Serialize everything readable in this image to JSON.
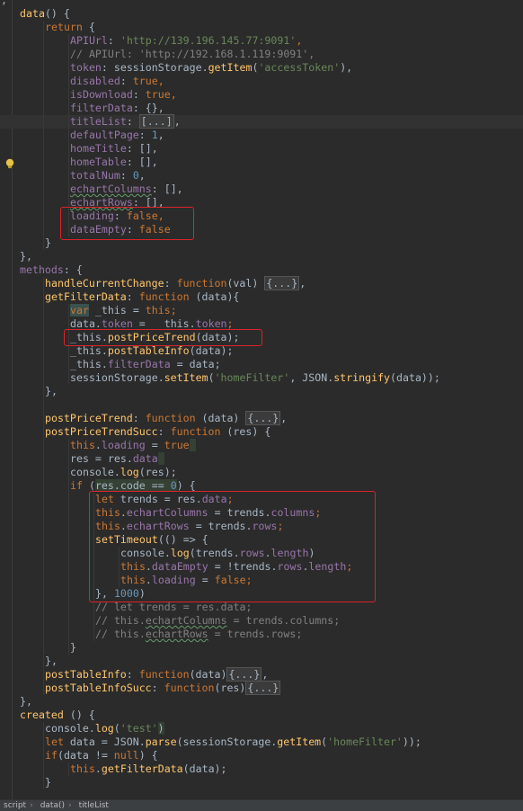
{
  "editor": {
    "lines": [
      {
        "indent": 0,
        "tokens": [
          {
            "t": "},",
            "c": "txt"
          }
        ]
      },
      {
        "indent": 1,
        "tokens": [
          {
            "t": "data",
            "c": "fn"
          },
          {
            "t": "() {",
            "c": "txt"
          }
        ]
      },
      {
        "indent": 2,
        "tokens": [
          {
            "t": "return",
            "c": "kw"
          },
          {
            "t": " {",
            "c": "txt"
          }
        ]
      },
      {
        "indent": 3,
        "tokens": [
          {
            "t": "APIUrl",
            "c": "prop"
          },
          {
            "t": ": ",
            "c": "txt"
          },
          {
            "t": "'http://139.196.145.77:9091'",
            "c": "str"
          },
          {
            "t": ",",
            "c": "kw"
          }
        ]
      },
      {
        "indent": 3,
        "tokens": [
          {
            "t": "// APIUrl: 'http://192.168.1.119:9091',",
            "c": "cmt"
          }
        ]
      },
      {
        "indent": 3,
        "tokens": [
          {
            "t": "token",
            "c": "prop"
          },
          {
            "t": ": sessionStorage.",
            "c": "txt"
          },
          {
            "t": "getItem",
            "c": "fn"
          },
          {
            "t": "(",
            "c": "txt"
          },
          {
            "t": "'accessToken'",
            "c": "str"
          },
          {
            "t": "),",
            "c": "txt"
          }
        ]
      },
      {
        "indent": 3,
        "tokens": [
          {
            "t": "disabled",
            "c": "prop"
          },
          {
            "t": ": ",
            "c": "txt"
          },
          {
            "t": "true",
            "c": "kw"
          },
          {
            "t": ",",
            "c": "kw"
          }
        ]
      },
      {
        "indent": 3,
        "tokens": [
          {
            "t": "isDownload",
            "c": "prop"
          },
          {
            "t": ": ",
            "c": "txt"
          },
          {
            "t": "true",
            "c": "kw"
          },
          {
            "t": ",",
            "c": "kw"
          }
        ]
      },
      {
        "indent": 3,
        "tokens": [
          {
            "t": "filterData",
            "c": "prop"
          },
          {
            "t": ": {},",
            "c": "txt"
          }
        ]
      },
      {
        "indent": 3,
        "caret": true,
        "tokens": [
          {
            "t": "titleList",
            "c": "prop"
          },
          {
            "t": ": ",
            "c": "txt"
          },
          {
            "t": "[...]",
            "c": "fold"
          },
          {
            "t": ",",
            "c": "txt"
          }
        ]
      },
      {
        "indent": 3,
        "tokens": [
          {
            "t": "defaultPage",
            "c": "prop"
          },
          {
            "t": ": ",
            "c": "txt"
          },
          {
            "t": "1",
            "c": "num"
          },
          {
            "t": ",",
            "c": "txt"
          }
        ]
      },
      {
        "indent": 3,
        "tokens": [
          {
            "t": "homeTitle",
            "c": "prop"
          },
          {
            "t": ": [],",
            "c": "txt"
          }
        ]
      },
      {
        "indent": 3,
        "tokens": [
          {
            "t": "homeTable",
            "c": "prop"
          },
          {
            "t": ": [],",
            "c": "txt"
          }
        ]
      },
      {
        "indent": 3,
        "tokens": [
          {
            "t": "totalNum",
            "c": "prop"
          },
          {
            "t": ": ",
            "c": "txt"
          },
          {
            "t": "0",
            "c": "num"
          },
          {
            "t": ",",
            "c": "txt"
          }
        ]
      },
      {
        "indent": 3,
        "tokens": [
          {
            "t": "echartColumns",
            "c": "prop squig"
          },
          {
            "t": ": [],",
            "c": "txt"
          }
        ]
      },
      {
        "indent": 3,
        "tokens": [
          {
            "t": "echartRows",
            "c": "prop squig"
          },
          {
            "t": ": [],",
            "c": "txt"
          }
        ]
      },
      {
        "indent": 3,
        "tokens": [
          {
            "t": "loading",
            "c": "prop"
          },
          {
            "t": ": ",
            "c": "txt"
          },
          {
            "t": "false",
            "c": "kw"
          },
          {
            "t": ",",
            "c": "kw"
          }
        ]
      },
      {
        "indent": 3,
        "tokens": [
          {
            "t": "dataEmpty",
            "c": "prop"
          },
          {
            "t": ": ",
            "c": "txt"
          },
          {
            "t": "false",
            "c": "kw"
          }
        ]
      },
      {
        "indent": 2,
        "tokens": [
          {
            "t": "}",
            "c": "txt"
          }
        ]
      },
      {
        "indent": 1,
        "tokens": [
          {
            "t": "},",
            "c": "txt"
          }
        ]
      },
      {
        "indent": 1,
        "tokens": [
          {
            "t": "methods",
            "c": "prop"
          },
          {
            "t": ": {",
            "c": "txt"
          }
        ]
      },
      {
        "indent": 2,
        "tokens": [
          {
            "t": "handleCurrentChange",
            "c": "fn"
          },
          {
            "t": ": ",
            "c": "txt"
          },
          {
            "t": "function",
            "c": "kw"
          },
          {
            "t": "(val) ",
            "c": "txt"
          },
          {
            "t": "{...}",
            "c": "fold"
          },
          {
            "t": ",",
            "c": "txt"
          }
        ]
      },
      {
        "indent": 2,
        "tokens": [
          {
            "t": "getFilterData",
            "c": "fn"
          },
          {
            "t": ": ",
            "c": "txt"
          },
          {
            "t": "function",
            "c": "kw"
          },
          {
            "t": " (data){",
            "c": "txt"
          }
        ]
      },
      {
        "indent": 3,
        "tokens": [
          {
            "t": "var",
            "c": "kw hl"
          },
          {
            "t": " _this = ",
            "c": "txt"
          },
          {
            "t": "this",
            "c": "kw"
          },
          {
            "t": ";",
            "c": "kw"
          }
        ]
      },
      {
        "indent": 3,
        "tokens": [
          {
            "t": "data.",
            "c": "txt"
          },
          {
            "t": "token",
            "c": "prop"
          },
          {
            "t": " =  ",
            "c": "txt"
          },
          {
            "t": "_this.",
            "c": "txt"
          },
          {
            "t": "token",
            "c": "prop"
          },
          {
            "t": ";",
            "c": "kw"
          }
        ]
      },
      {
        "indent": 3,
        "tokens": [
          {
            "t": "_this.",
            "c": "txt"
          },
          {
            "t": "postPriceTrend",
            "c": "fn"
          },
          {
            "t": "(data);",
            "c": "txt"
          }
        ]
      },
      {
        "indent": 3,
        "tokens": [
          {
            "t": "_this.",
            "c": "txt"
          },
          {
            "t": "postTableInfo",
            "c": "fn"
          },
          {
            "t": "(data);",
            "c": "txt"
          }
        ]
      },
      {
        "indent": 3,
        "tokens": [
          {
            "t": "_this.",
            "c": "txt"
          },
          {
            "t": "filterData",
            "c": "prop"
          },
          {
            "t": " = data;",
            "c": "txt"
          }
        ]
      },
      {
        "indent": 3,
        "tokens": [
          {
            "t": "sessionStorage.",
            "c": "txt"
          },
          {
            "t": "setItem",
            "c": "fn"
          },
          {
            "t": "(",
            "c": "txt"
          },
          {
            "t": "'homeFilter'",
            "c": "str"
          },
          {
            "t": ", JSON.",
            "c": "txt"
          },
          {
            "t": "stringify",
            "c": "fn"
          },
          {
            "t": "(data));",
            "c": "txt"
          }
        ]
      },
      {
        "indent": 2,
        "tokens": [
          {
            "t": "},",
            "c": "txt"
          }
        ]
      },
      {
        "indent": 2,
        "tokens": [
          {
            "t": "",
            "c": "txt"
          }
        ]
      },
      {
        "indent": 2,
        "tokens": [
          {
            "t": "postPriceTrend",
            "c": "fn"
          },
          {
            "t": ": ",
            "c": "txt"
          },
          {
            "t": "function",
            "c": "kw"
          },
          {
            "t": " (data) ",
            "c": "txt"
          },
          {
            "t": "{...}",
            "c": "fold"
          },
          {
            "t": ",",
            "c": "txt"
          }
        ]
      },
      {
        "indent": 2,
        "tokens": [
          {
            "t": "postPriceTrendSucc",
            "c": "fn"
          },
          {
            "t": ": ",
            "c": "txt"
          },
          {
            "t": "function",
            "c": "kw"
          },
          {
            "t": " (res) {",
            "c": "txt"
          }
        ]
      },
      {
        "indent": 3,
        "tokens": [
          {
            "t": "this",
            "c": "kw"
          },
          {
            "t": ".",
            "c": "txt"
          },
          {
            "t": "loading",
            "c": "prop"
          },
          {
            "t": " = ",
            "c": "txt"
          },
          {
            "t": "true",
            "c": "kw"
          },
          {
            "t": " ",
            "c": "hl2"
          }
        ]
      },
      {
        "indent": 3,
        "tokens": [
          {
            "t": "res = res.",
            "c": "txt"
          },
          {
            "t": "data",
            "c": "prop"
          },
          {
            "t": " ",
            "c": "hl2"
          }
        ]
      },
      {
        "indent": 3,
        "tokens": [
          {
            "t": "console.",
            "c": "txt"
          },
          {
            "t": "log",
            "c": "fn"
          },
          {
            "t": "(res);",
            "c": "txt"
          }
        ]
      },
      {
        "indent": 3,
        "tokens": [
          {
            "t": "if",
            "c": "kw"
          },
          {
            "t": " (",
            "c": "txt"
          },
          {
            "t": "res.code == ",
            "c": "txt hl2"
          },
          {
            "t": "0",
            "c": "num hl2"
          },
          {
            "t": ") {",
            "c": "txt"
          }
        ]
      },
      {
        "indent": 4,
        "tokens": [
          {
            "t": "let",
            "c": "kw"
          },
          {
            "t": " trends = res.",
            "c": "txt"
          },
          {
            "t": "data",
            "c": "prop"
          },
          {
            "t": ";",
            "c": "kw"
          }
        ]
      },
      {
        "indent": 4,
        "tokens": [
          {
            "t": "this",
            "c": "kw"
          },
          {
            "t": ".",
            "c": "txt"
          },
          {
            "t": "echartColumns",
            "c": "prop"
          },
          {
            "t": " = trends.",
            "c": "txt"
          },
          {
            "t": "columns",
            "c": "prop"
          },
          {
            "t": ";",
            "c": "kw"
          }
        ]
      },
      {
        "indent": 4,
        "tokens": [
          {
            "t": "this",
            "c": "kw"
          },
          {
            "t": ".",
            "c": "txt"
          },
          {
            "t": "echartRows",
            "c": "prop"
          },
          {
            "t": " = trends.",
            "c": "txt"
          },
          {
            "t": "rows",
            "c": "prop"
          },
          {
            "t": ";",
            "c": "kw"
          }
        ]
      },
      {
        "indent": 4,
        "tokens": [
          {
            "t": "setTimeout",
            "c": "fn"
          },
          {
            "t": "(() => {",
            "c": "txt"
          }
        ]
      },
      {
        "indent": 5,
        "tokens": [
          {
            "t": "console.",
            "c": "txt"
          },
          {
            "t": "log",
            "c": "fn"
          },
          {
            "t": "(trends.",
            "c": "txt"
          },
          {
            "t": "rows",
            "c": "prop"
          },
          {
            "t": ".",
            "c": "txt"
          },
          {
            "t": "length",
            "c": "prop"
          },
          {
            "t": ")",
            "c": "txt"
          }
        ]
      },
      {
        "indent": 5,
        "tokens": [
          {
            "t": "this",
            "c": "kw"
          },
          {
            "t": ".",
            "c": "txt"
          },
          {
            "t": "dataEmpty",
            "c": "prop"
          },
          {
            "t": " = !trends.",
            "c": "txt"
          },
          {
            "t": "rows",
            "c": "prop"
          },
          {
            "t": ".",
            "c": "txt"
          },
          {
            "t": "length",
            "c": "prop"
          },
          {
            "t": ";",
            "c": "kw"
          }
        ]
      },
      {
        "indent": 5,
        "tokens": [
          {
            "t": "this",
            "c": "kw"
          },
          {
            "t": ".",
            "c": "txt"
          },
          {
            "t": "loading",
            "c": "prop"
          },
          {
            "t": " = ",
            "c": "txt"
          },
          {
            "t": "false",
            "c": "kw"
          },
          {
            "t": ";",
            "c": "kw"
          }
        ]
      },
      {
        "indent": 4,
        "tokens": [
          {
            "t": "}, ",
            "c": "txt"
          },
          {
            "t": "1000",
            "c": "num"
          },
          {
            "t": ")",
            "c": "txt"
          }
        ]
      },
      {
        "indent": 4,
        "tokens": [
          {
            "t": "// let trends = res.data;",
            "c": "cmt"
          }
        ]
      },
      {
        "indent": 4,
        "tokens": [
          {
            "t": "// this.",
            "c": "cmt"
          },
          {
            "t": "echartColumns",
            "c": "cmt squig"
          },
          {
            "t": " = trends.columns;",
            "c": "cmt"
          }
        ]
      },
      {
        "indent": 4,
        "tokens": [
          {
            "t": "// this.",
            "c": "cmt"
          },
          {
            "t": "echartRows",
            "c": "cmt squig"
          },
          {
            "t": " = trends.rows;",
            "c": "cmt"
          }
        ]
      },
      {
        "indent": 3,
        "tokens": [
          {
            "t": "}",
            "c": "txt"
          }
        ]
      },
      {
        "indent": 2,
        "tokens": [
          {
            "t": "},",
            "c": "txt"
          }
        ]
      },
      {
        "indent": 2,
        "tokens": [
          {
            "t": "postTableInfo",
            "c": "fn"
          },
          {
            "t": ": ",
            "c": "txt"
          },
          {
            "t": "function",
            "c": "kw"
          },
          {
            "t": "(data)",
            "c": "txt"
          },
          {
            "t": "{...}",
            "c": "fold"
          },
          {
            "t": ",",
            "c": "txt"
          }
        ]
      },
      {
        "indent": 2,
        "tokens": [
          {
            "t": "postTableInfoSucc",
            "c": "fn"
          },
          {
            "t": ": ",
            "c": "txt"
          },
          {
            "t": "function",
            "c": "kw"
          },
          {
            "t": "(res)",
            "c": "txt"
          },
          {
            "t": "{...}",
            "c": "fold"
          }
        ]
      },
      {
        "indent": 1,
        "tokens": [
          {
            "t": "},",
            "c": "txt"
          }
        ]
      },
      {
        "indent": 1,
        "tokens": [
          {
            "t": "created",
            "c": "fn"
          },
          {
            "t": " () {",
            "c": "txt"
          }
        ]
      },
      {
        "indent": 2,
        "tokens": [
          {
            "t": "console.",
            "c": "txt"
          },
          {
            "t": "log",
            "c": "fn"
          },
          {
            "t": "(",
            "c": "txt"
          },
          {
            "t": "'test'",
            "c": "str"
          },
          {
            "t": ")",
            "c": "txt hl2"
          }
        ]
      },
      {
        "indent": 2,
        "tokens": [
          {
            "t": "let",
            "c": "kw"
          },
          {
            "t": " data = JSON.",
            "c": "txt"
          },
          {
            "t": "parse",
            "c": "fn"
          },
          {
            "t": "(sessionStorage.",
            "c": "txt"
          },
          {
            "t": "getItem",
            "c": "fn"
          },
          {
            "t": "(",
            "c": "txt"
          },
          {
            "t": "'homeFilter'",
            "c": "str"
          },
          {
            "t": "));",
            "c": "txt"
          }
        ]
      },
      {
        "indent": 2,
        "tokens": [
          {
            "t": "if",
            "c": "kw"
          },
          {
            "t": "(data != ",
            "c": "txt"
          },
          {
            "t": "null",
            "c": "kw"
          },
          {
            "t": ") {",
            "c": "txt"
          }
        ]
      },
      {
        "indent": 3,
        "tokens": [
          {
            "t": "this",
            "c": "kw"
          },
          {
            "t": ".",
            "c": "txt"
          },
          {
            "t": "getFilterData",
            "c": "fn"
          },
          {
            "t": "(data);",
            "c": "txt"
          }
        ]
      },
      {
        "indent": 2,
        "tokens": [
          {
            "t": "}",
            "c": "txt"
          }
        ]
      },
      {
        "indent": 0,
        "tokens": [
          {
            "t": "}",
            "c": "txt"
          }
        ]
      }
    ]
  },
  "statusbar": {
    "crumbs": [
      "script",
      "data()",
      "titleList"
    ]
  }
}
